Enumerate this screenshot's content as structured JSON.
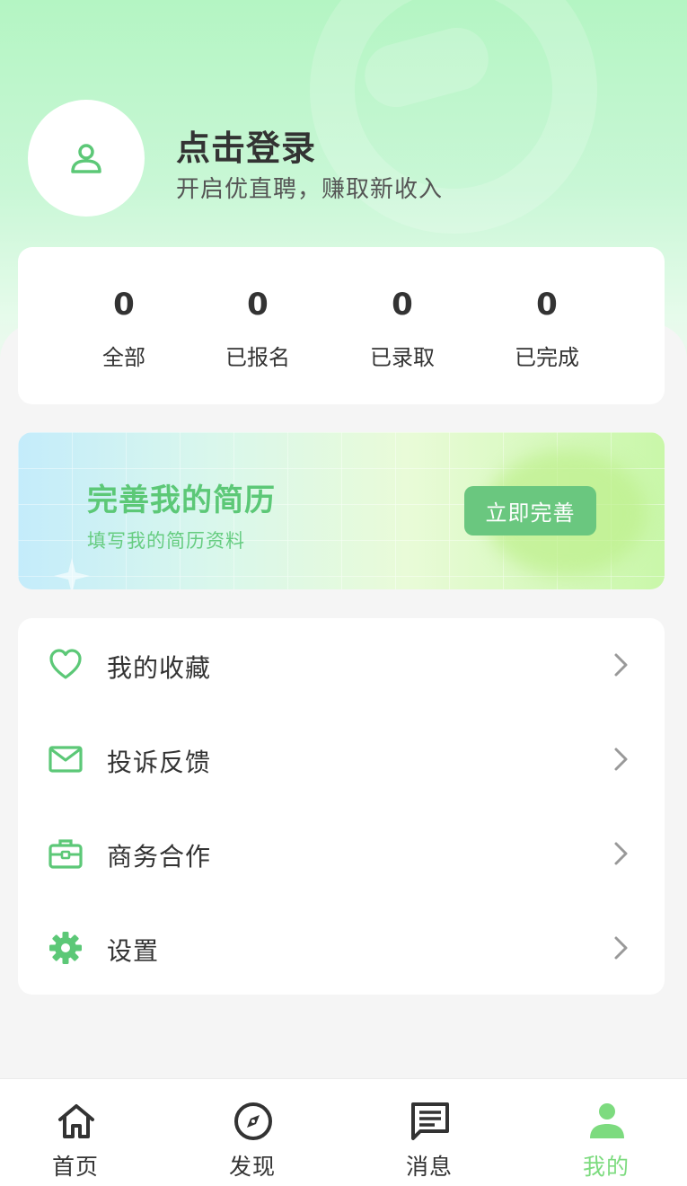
{
  "header": {
    "login_title": "点击登录",
    "login_subtitle": "开启优直聘，赚取新收入"
  },
  "stats": [
    {
      "value": "0",
      "label": "全部"
    },
    {
      "value": "0",
      "label": "已报名"
    },
    {
      "value": "0",
      "label": "已录取"
    },
    {
      "value": "0",
      "label": "已完成"
    }
  ],
  "banner": {
    "title": "完善我的简历",
    "subtitle": "填写我的简历资料",
    "button_label": "立即完善"
  },
  "menu": {
    "items": [
      {
        "label": "我的收藏",
        "icon": "heart-icon"
      },
      {
        "label": "投诉反馈",
        "icon": "mail-icon"
      },
      {
        "label": "商务合作",
        "icon": "briefcase-icon"
      },
      {
        "label": "设置",
        "icon": "gear-icon"
      }
    ]
  },
  "tabbar": {
    "tabs": [
      {
        "label": "首页",
        "icon": "home-icon"
      },
      {
        "label": "发现",
        "icon": "compass-icon"
      },
      {
        "label": "消息",
        "icon": "message-icon"
      },
      {
        "label": "我的",
        "icon": "user-icon",
        "active": true
      }
    ]
  },
  "colors": {
    "accent": "#6ac77f",
    "active_tab": "#7ddb7f",
    "header_gradient_top": "#b4f5c3"
  }
}
